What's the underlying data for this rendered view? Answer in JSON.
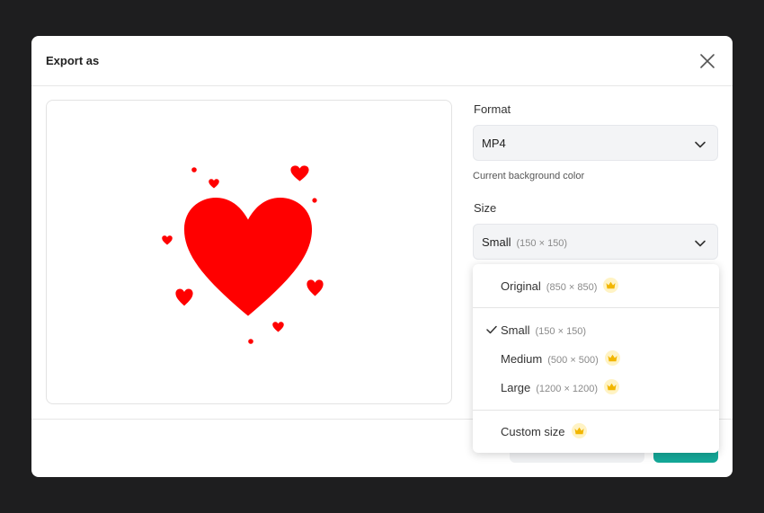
{
  "dialog": {
    "title": "Export as"
  },
  "format": {
    "label": "Format",
    "value": "MP4",
    "helper": "Current background color"
  },
  "size": {
    "label": "Size",
    "value": "Small",
    "value_dim": "(150 × 150)",
    "options": [
      {
        "label": "Original",
        "dim": "(850 × 850)",
        "premium": true,
        "selected": false
      },
      {
        "label": "Small",
        "dim": "(150 × 150)",
        "premium": false,
        "selected": true
      },
      {
        "label": "Medium",
        "dim": "(500 × 500)",
        "premium": true,
        "selected": false
      },
      {
        "label": "Large",
        "dim": "(1200 × 1200)",
        "premium": true,
        "selected": false
      },
      {
        "label": "Custom size",
        "dim": "",
        "premium": true,
        "selected": false
      }
    ]
  },
  "colors": {
    "heart": "#ff0000",
    "primary_button": "#14a898",
    "crown": "#f2b600",
    "crown_bg": "#fff3c4"
  },
  "icons": {
    "close": "close-icon",
    "chevron": "chevron-down-icon",
    "check": "check-icon",
    "premium": "crown-icon"
  }
}
